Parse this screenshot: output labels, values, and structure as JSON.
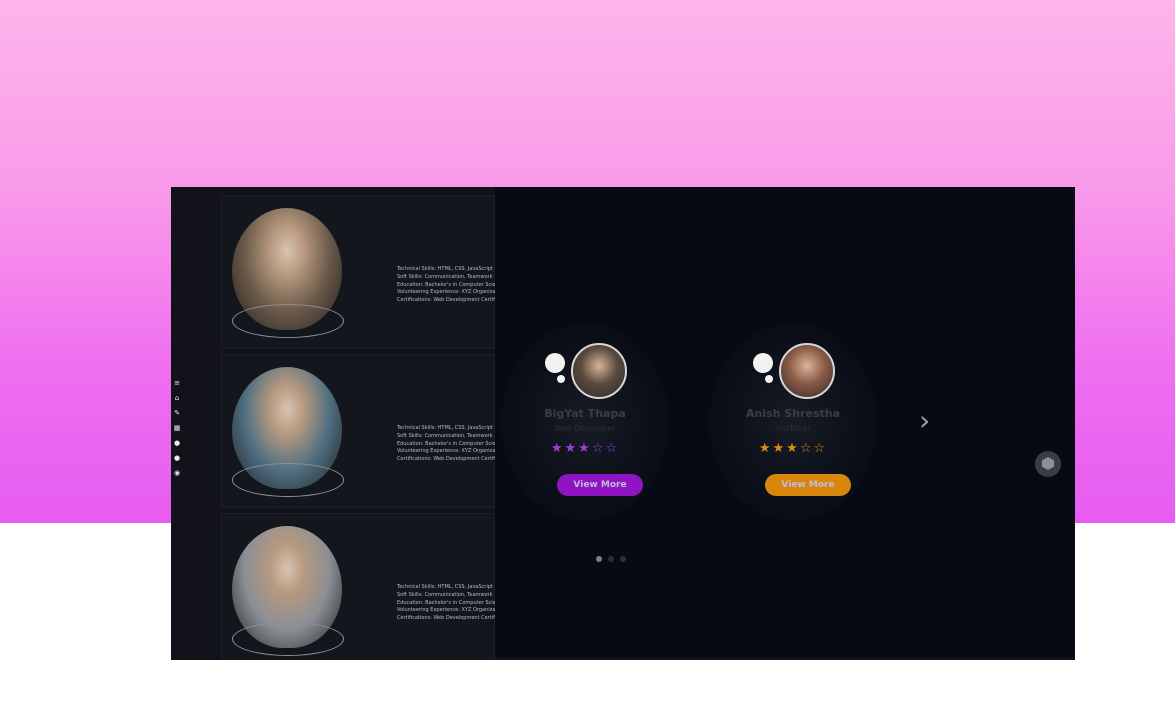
{
  "nav": {
    "icons": [
      "menu-icon",
      "home-icon",
      "pencil-icon",
      "book-icon",
      "user-icon",
      "info-icon",
      "settings-icon"
    ],
    "glyphs": [
      "≡",
      "⌂",
      "✎",
      "▦",
      "●",
      "●",
      "◉"
    ]
  },
  "profiles": [
    {
      "photo_tone": "#6b5a4a",
      "lines": [
        "Technical Skills: HTML, CSS, JavaScript",
        "Soft Skills: Communication, Teamwork",
        "Education: Bachelor's in Computer Science",
        "Volunteering Experience: XYZ Organization",
        "Certifications: Web Development Certific"
      ]
    },
    {
      "photo_tone": "#4f6f82",
      "lines": [
        "Technical Skills: HTML, CSS, JavaScript",
        "Soft Skills: Communication, Teamwork",
        "Education: Bachelor's in Computer Science",
        "Volunteering Experience: XYZ Organization",
        "Certifications: Web Development Certific"
      ]
    },
    {
      "photo_tone": "#8a8f95",
      "lines": [
        "Technical Skills: HTML, CSS, JavaScript",
        "Soft Skills: Communication, Teamwork",
        "Education: Bachelor's in Computer Science",
        "Volunteering Experience: XYZ Organization",
        "Certifications: Web Development Certific"
      ]
    }
  ],
  "slider": {
    "cards": [
      {
        "name": "BigYat Thapa",
        "role": "Web Developer",
        "rating": 3,
        "star_color": "#a13ddc",
        "button_label": "View More",
        "button_color": "#8f14c4",
        "avatar_tone": "#5a4a3e"
      },
      {
        "name": "Anish Shrestha",
        "role": "YouTuber",
        "rating": 3,
        "star_color": "#e08a12",
        "button_label": "View More",
        "button_color": "#d9860c",
        "avatar_tone": "#8a5a46"
      }
    ],
    "pagination": {
      "count": 3,
      "active": 0
    },
    "next_glyph": "›"
  },
  "colors": {
    "page_gradient_top": "#fdb6ea",
    "page_gradient_bottom": "#e65cf0",
    "panel_dark": "#060a14",
    "frame_dark": "#12131a"
  }
}
